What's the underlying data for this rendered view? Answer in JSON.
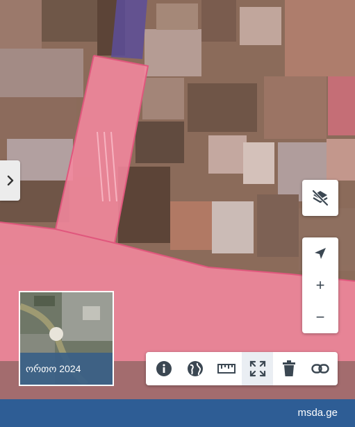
{
  "map": {
    "sidebar_toggle_icon": "chevron-right-icon",
    "layer_toggle_icon": "layers-off-icon",
    "controls": {
      "locate_icon": "navigation-arrow-icon",
      "zoom_in_label": "+",
      "zoom_out_label": "−"
    },
    "basemap": {
      "label": "ორთო 2024"
    },
    "toolbar": [
      {
        "name": "info",
        "icon": "info-icon"
      },
      {
        "name": "globe",
        "icon": "globe-icon"
      },
      {
        "name": "measure",
        "icon": "ruler-icon"
      },
      {
        "name": "fullscreen",
        "icon": "fullscreen-icon",
        "active": true
      },
      {
        "name": "delete",
        "icon": "trash-icon"
      },
      {
        "name": "link",
        "icon": "link-icon"
      }
    ]
  },
  "footer": {
    "brand": "msda.ge"
  },
  "colors": {
    "overlay_pink": "#f4889e",
    "footer_blue": "#2e5d95",
    "icon_dark": "#3b4752"
  }
}
